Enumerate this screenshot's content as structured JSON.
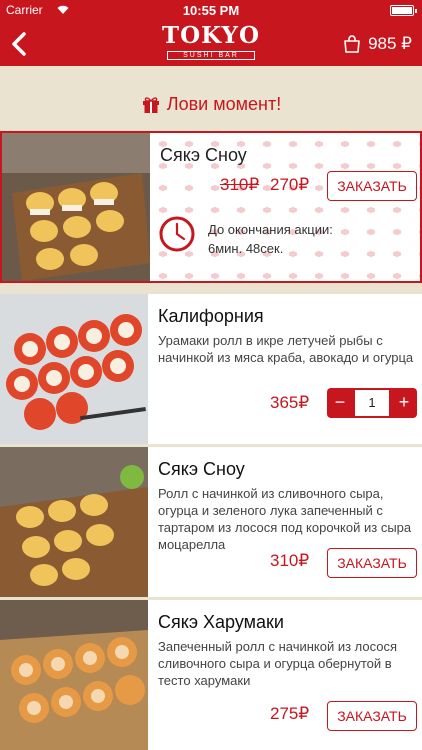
{
  "status": {
    "carrier": "Carrier",
    "time": "10:55 PM"
  },
  "header": {
    "logo_title": "TOKYO",
    "logo_sub": "SUSHI BAR",
    "cart_total": "985 ₽"
  },
  "promo": {
    "heading": "Лови момент!",
    "name": "Сякэ Сноу",
    "old_price": "310₽",
    "new_price": "270₽",
    "order_label": "ЗАКАЗАТЬ",
    "timer_label": "До окончания акции:",
    "timer_value": "6мин. 48сек."
  },
  "products": [
    {
      "name": "Калифорния",
      "description": "Урамаки ролл в икре летучей рыбы с начинкой из мяса краба, авокадо и огурца",
      "price": "365₽",
      "quantity": "1",
      "minus": "−",
      "plus": "+"
    },
    {
      "name": "Сякэ Сноу",
      "description": "Ролл с начинкой из сливочного сыра, огурца и зеленого лука запеченный с тартаром из лосося под корочкой из сыра моцарелла",
      "price": "310₽",
      "order_label": "ЗАКАЗАТЬ"
    },
    {
      "name": "Сякэ Харумаки",
      "description": "Запеченный ролл с начинкой из лосося сливочного сыра и огурца обернутой в тесто харумаки",
      "price": "275₽",
      "order_label": "ЗАКАЗАТЬ"
    }
  ],
  "colors": {
    "accent": "#c8161e",
    "background": "#e9e3cf"
  }
}
